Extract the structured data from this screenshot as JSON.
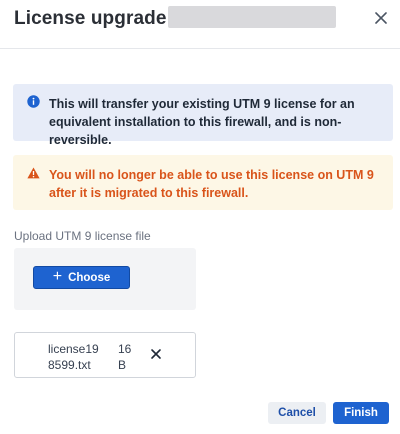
{
  "dialog": {
    "title": "License upgrade -",
    "close_icon": "close-icon"
  },
  "info_banner": {
    "icon": "info-circle-icon",
    "text": "This will transfer your existing UTM 9 license for an equivalent installation to this firewall, and is non-reversible.",
    "background": "#e7ecf8",
    "icon_color": "#1e63d0"
  },
  "warning_banner": {
    "icon": "warning-triangle-icon",
    "text": "You will no longer be able to use this license on UTM 9 after it is migrated to this firewall.",
    "background": "#fdf7e6",
    "text_color": "#d9541a"
  },
  "upload": {
    "label": "Upload UTM 9 license file",
    "choose_icon": "plus-icon",
    "choose_label": "Choose"
  },
  "file": {
    "name": "license198599.txt",
    "size": "16 B",
    "remove_icon": "close-icon"
  },
  "footer": {
    "cancel_label": "Cancel",
    "finish_label": "Finish"
  },
  "colors": {
    "primary": "#1e63d0",
    "secondary_text": "#1e4fa8"
  }
}
